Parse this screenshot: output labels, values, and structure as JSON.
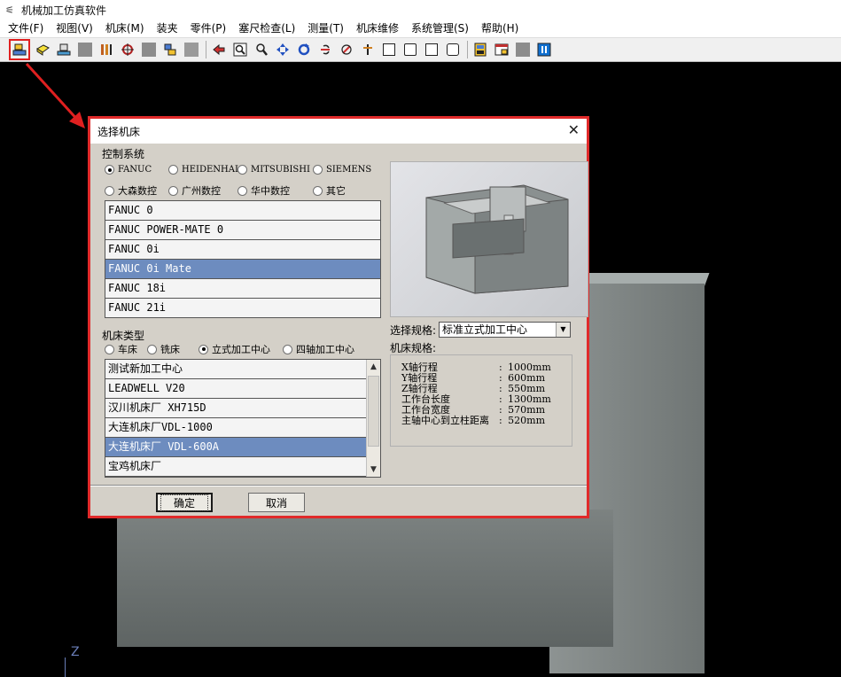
{
  "window": {
    "title": "机械加工仿真软件"
  },
  "menu": [
    "文件(F)",
    "视图(V)",
    "机床(M)",
    "装夹",
    "零件(P)",
    "塞尺检查(L)",
    "测量(T)",
    "机床维修",
    "系统管理(S)",
    "帮助(H)"
  ],
  "viewport": {
    "axis_label": "Z"
  },
  "dialog": {
    "title": "选择机床",
    "control_group_label": "控制系统",
    "control_systems": [
      {
        "label": "FANUC",
        "checked": true
      },
      {
        "label": "HEIDENHAI",
        "checked": false
      },
      {
        "label": "MITSUBISHI",
        "checked": false
      },
      {
        "label": "SIEMENS",
        "checked": false
      },
      {
        "label": "大森数控",
        "checked": false
      },
      {
        "label": "广州数控",
        "checked": false
      },
      {
        "label": "华中数控",
        "checked": false
      },
      {
        "label": "其它",
        "checked": false
      }
    ],
    "control_list": [
      "FANUC 0",
      "FANUC POWER-MATE 0",
      "FANUC 0i",
      "FANUC 0i Mate",
      "FANUC 18i",
      "FANUC 21i"
    ],
    "control_selected": "FANUC 0i Mate",
    "machine_type_label": "机床类型",
    "machine_types": [
      {
        "label": "车床",
        "checked": false
      },
      {
        "label": "铣床",
        "checked": false
      },
      {
        "label": "立式加工中心",
        "checked": true
      },
      {
        "label": "四轴加工中心",
        "checked": false
      }
    ],
    "machine_list": [
      "测试新加工中心",
      "LEADWELL V20",
      "汉川机床厂 XH715D",
      "大连机床厂VDL-1000",
      "大连机床厂 VDL-600A",
      "宝鸡机床厂"
    ],
    "machine_selected": "大连机床厂 VDL-600A",
    "spec_select_label": "选择规格:",
    "spec_select_value": "标准立式加工中心",
    "spec_label": "机床规格:",
    "specs": [
      {
        "name": "X轴行程",
        "value": "1000mm"
      },
      {
        "name": "Y轴行程",
        "value": "600mm"
      },
      {
        "name": "Z轴行程",
        "value": "550mm"
      },
      {
        "name": "工作台长度",
        "value": "1300mm"
      },
      {
        "name": "工作台宽度",
        "value": "570mm"
      },
      {
        "name": "主轴中心到立柱距离",
        "value": "520mm"
      }
    ],
    "ok_label": "确定",
    "cancel_label": "取消"
  },
  "icons": [
    "open-machine-icon",
    "part-icon",
    "fixture-icon",
    "tool-icon",
    "workpiece-icon",
    "cube-view-icon",
    "help-icon"
  ]
}
